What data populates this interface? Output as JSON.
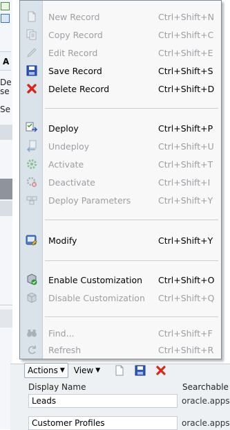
{
  "menu": {
    "items": [
      {
        "label": "New Record",
        "shortcut": "Ctrl+Shift+N",
        "icon": "new-record-icon",
        "enabled": false
      },
      {
        "label": "Copy Record",
        "shortcut": "Ctrl+Shift+C",
        "icon": "copy-record-icon",
        "enabled": false
      },
      {
        "label": "Edit Record",
        "shortcut": "Ctrl+Shift+E",
        "icon": "pencil-icon",
        "enabled": false
      },
      {
        "label": "Save Record",
        "shortcut": "Ctrl+Shift+S",
        "icon": "save-icon",
        "enabled": true
      },
      {
        "label": "Delete Record",
        "shortcut": "Ctrl+Shift+D",
        "icon": "red-x-icon",
        "enabled": true
      },
      {
        "label": "Deploy",
        "shortcut": "Ctrl+Shift+P",
        "icon": "deploy-icon",
        "enabled": true
      },
      {
        "label": "Undeploy",
        "shortcut": "Ctrl+Shift+U",
        "icon": "undeploy-icon",
        "enabled": false
      },
      {
        "label": "Activate",
        "shortcut": "Ctrl+Shift+T",
        "icon": "activate-gear-icon",
        "enabled": false
      },
      {
        "label": "Deactivate",
        "shortcut": "Ctrl+Shift+I",
        "icon": "deactivate-gear-icon",
        "enabled": false
      },
      {
        "label": "Deploy Parameters",
        "shortcut": "Ctrl+Shift+Y",
        "icon": "deploy-parameters-icon",
        "enabled": false
      },
      {
        "label": "Modify",
        "shortcut": "Ctrl+Shift+Y",
        "icon": "modify-icon",
        "enabled": true
      },
      {
        "label": "Enable Customization",
        "shortcut": "Ctrl+Shift+O",
        "icon": "enable-customization-icon",
        "enabled": true
      },
      {
        "label": "Disable Customization",
        "shortcut": "Ctrl+Shift+Q",
        "icon": "disable-customization-icon",
        "enabled": false
      },
      {
        "label": "Find...",
        "shortcut": "Ctrl+Shift+F",
        "icon": "binoculars-icon",
        "enabled": false
      },
      {
        "label": "Refresh",
        "shortcut": "Ctrl+Shift+R",
        "icon": "refresh-icon",
        "enabled": false
      }
    ]
  },
  "background": {
    "tab_letter": "A",
    "text_fragments": [
      "De",
      "se",
      "Se"
    ]
  },
  "toolbar": {
    "actions_label": "Actions",
    "view_label": "View"
  },
  "table": {
    "columns": [
      "Display Name",
      "Searchable O"
    ],
    "rows": [
      {
        "display_name": "Leads",
        "searchable": "oracle.apps"
      },
      {
        "display_name": "Customer Profiles",
        "searchable": "oracle.apps"
      }
    ]
  },
  "colors": {
    "menu_background": "#f8f8f8",
    "menu_gutter": "#dbe3ea",
    "disabled_text": "#9a9ea3",
    "enabled_text": "#000000",
    "delete_red": "#d8261c"
  }
}
